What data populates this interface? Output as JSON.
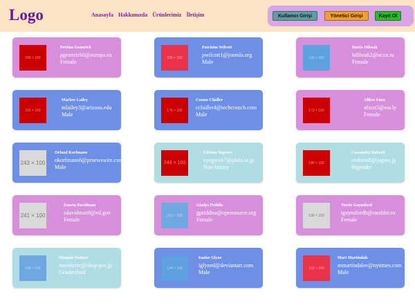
{
  "header": {
    "logo": "Logo",
    "nav": [
      "Anasayfa",
      "Hakkımızda",
      "Ürünlerimiz",
      "İletişim"
    ],
    "buttons": {
      "user_login": "Kullanıcı Girişi",
      "admin_login": "Yönetici Girişi",
      "register": "Kayıt Ol"
    }
  },
  "colors": {
    "header_bg": "#fbe3c4",
    "logo": "#6a1b9a",
    "nav": "#7b1fa2",
    "auth_panel": "#d8a6e8",
    "card_purple": "#d88fdb",
    "card_blue": "#6d8fe6",
    "card_teal": "#b0dde4",
    "thumb_red": "#cc0000",
    "thumb_crimson": "#e8334a",
    "thumb_blue": "#5ea1e0",
    "thumb_lightblue": "#6fa8e0",
    "thumb_gray": "#d9d9d9"
  },
  "users": [
    {
      "name": "Petrina Gennrich",
      "email": "pgennrich0@europa.eu",
      "gender": "Female",
      "thumb_label": "206 × 100"
    },
    {
      "name": "Patrizius Wilcott",
      "email": "pwilcott1@joomla.org",
      "gender": "Male",
      "thumb_label": "206 × 100"
    },
    {
      "name": "Hattie Dibnah",
      "email": "hdibnah2@ucoz.ru",
      "gender": "Female",
      "thumb_label": "156 × 100"
    },
    {
      "name": "Marlow Lailey",
      "email": "mlailey3@arizona.edu",
      "gender": "Male",
      "thumb_label": "115 × 100"
    },
    {
      "name": "Cozmo Chidler",
      "email": "cchidler4@techcrunch.com",
      "gender": "Male",
      "thumb_label": "176 × 100"
    },
    {
      "name": "Allkee Foux",
      "email": "afoux5@ow.ly",
      "gender": "Female",
      "thumb_label": "173 × 100"
    },
    {
      "name": "Orland Korfmann",
      "email": "okorfmann6@prnewswire.com",
      "gender": "Male",
      "thumb_label": "243 × 100"
    },
    {
      "name": "Edwina Yegorov",
      "email": "eyegorov7@plala.or.jp",
      "gender": "Non-binary",
      "thumb_label": "244 × 100"
    },
    {
      "name": "Cassandry Ruberti",
      "email": "cruberti8@jugem.jp",
      "gender": "Bigender",
      "thumb_label": "186 × 100"
    },
    {
      "name": "Zaneta Davidman",
      "email": "zdavidman9@ed.gov",
      "gender": "Female",
      "thumb_label": "241 × 100"
    },
    {
      "name": "Gladys Priddis",
      "email": "gpriddisa@opensource.org",
      "gender": "Female",
      "thumb_label": "201 × 100"
    },
    {
      "name": "Torrie Gaynsford",
      "email": "tgaynsfordb@rambler.ru",
      "gender": "Female",
      "thumb_label": "190 × 100"
    },
    {
      "name": "Minnnie Switzer",
      "email": "mswitzerc@shop-pro.jp",
      "gender": "Genderfluid",
      "thumb_label": "185 × 100"
    },
    {
      "name": "Isador Glyne",
      "email": "iglyned@deviantart.com",
      "gender": "Male",
      "thumb_label": "124 × 100"
    },
    {
      "name": "Mart Martindale",
      "email": "mmartindalee@nytimes.com",
      "gender": "Male",
      "thumb_label": "169 × 100"
    }
  ]
}
